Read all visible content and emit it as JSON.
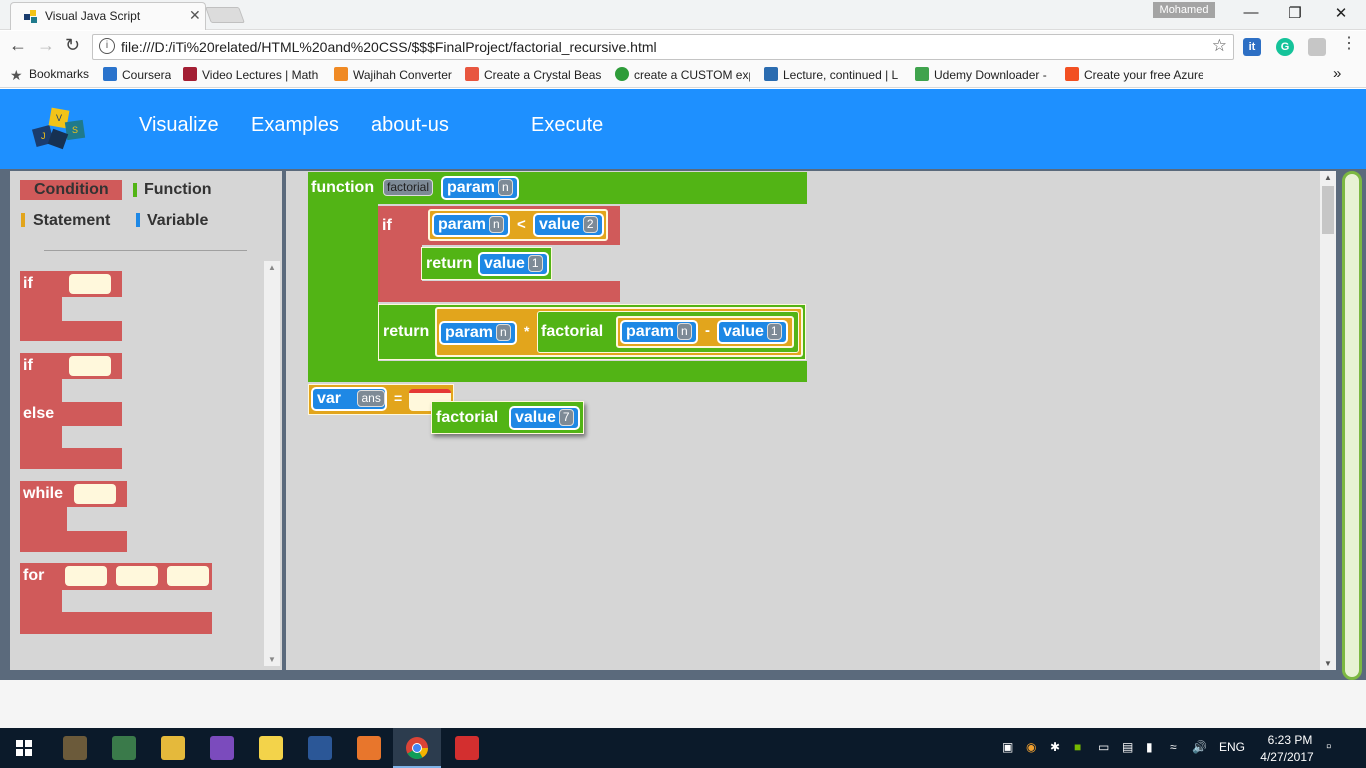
{
  "browser": {
    "tab_title": "Visual Java Script",
    "tab_close": "✕",
    "profile_name": "Mohamed",
    "window_minimize": "—",
    "window_restore": "❐",
    "window_close": "✕",
    "url": "file:///D:/iTi%20related/HTML%20and%20CSS/$$$FinalProject/factorial_recursive.html",
    "bookmarks": [
      {
        "label": "Bookmarks",
        "color": "#555555"
      },
      {
        "label": "Coursera",
        "color": "#2a73cc"
      },
      {
        "label": "Video Lectures | Math",
        "color": "#a31f34"
      },
      {
        "label": "Wajihah Converter",
        "color": "#f08a24"
      },
      {
        "label": "Create a Crystal Beast",
        "color": "#e8563f"
      },
      {
        "label": "create a CUSTOM exp",
        "color": "#2e9c3a"
      },
      {
        "label": "Lecture, continued | L",
        "color": "#2b6cb0"
      },
      {
        "label": "Udemy Downloader -",
        "color": "#3fa34d"
      },
      {
        "label": "Create your free Azure",
        "color": "#f25022"
      }
    ],
    "more_bookmarks": "»"
  },
  "site": {
    "nav": [
      "Visualize",
      "Examples",
      "about-us",
      "Execute"
    ],
    "logo_letters": [
      "J",
      "V",
      "S"
    ]
  },
  "palette": {
    "categories": [
      {
        "label": "Condition",
        "color": "#d05a5a"
      },
      {
        "label": "Function",
        "color": "#52b415"
      },
      {
        "label": "Statement",
        "color": "#e2a51c"
      },
      {
        "label": "Variable",
        "color": "#1e88e5"
      }
    ],
    "blocks": {
      "if1": "if",
      "if2": "if",
      "else": "else",
      "while": "while",
      "for": "for"
    },
    "scroll_up": "▲",
    "scroll_down": "▼"
  },
  "workspace": {
    "function_kw": "function",
    "function_name": "factorial",
    "param_kw": "param",
    "param_name": "n",
    "if_kw": "if",
    "cond_param_kw": "param",
    "cond_param_name": "n",
    "lt_op": "<",
    "cond_value_kw": "value",
    "cond_value": "2",
    "return1_kw": "return",
    "return1_value_kw": "value",
    "return1_value": "1",
    "return2_kw": "return",
    "mul_param_kw": "param",
    "mul_param_name": "n",
    "mul_op": "*",
    "call_kw": "factorial",
    "arg_param_kw": "param",
    "arg_param_name": "n",
    "minus_op": "-",
    "arg_value_kw": "value",
    "arg_value": "1",
    "var_kw": "var",
    "var_name": "ans",
    "assign_op": "=",
    "call2_kw": "factorial",
    "call2_value_kw": "value",
    "call2_value": "7",
    "scroll_up": "▲",
    "scroll_down": "▼"
  },
  "taskbar": {
    "language": "ENG",
    "time": "6:23 PM",
    "date": "4/27/2017"
  }
}
